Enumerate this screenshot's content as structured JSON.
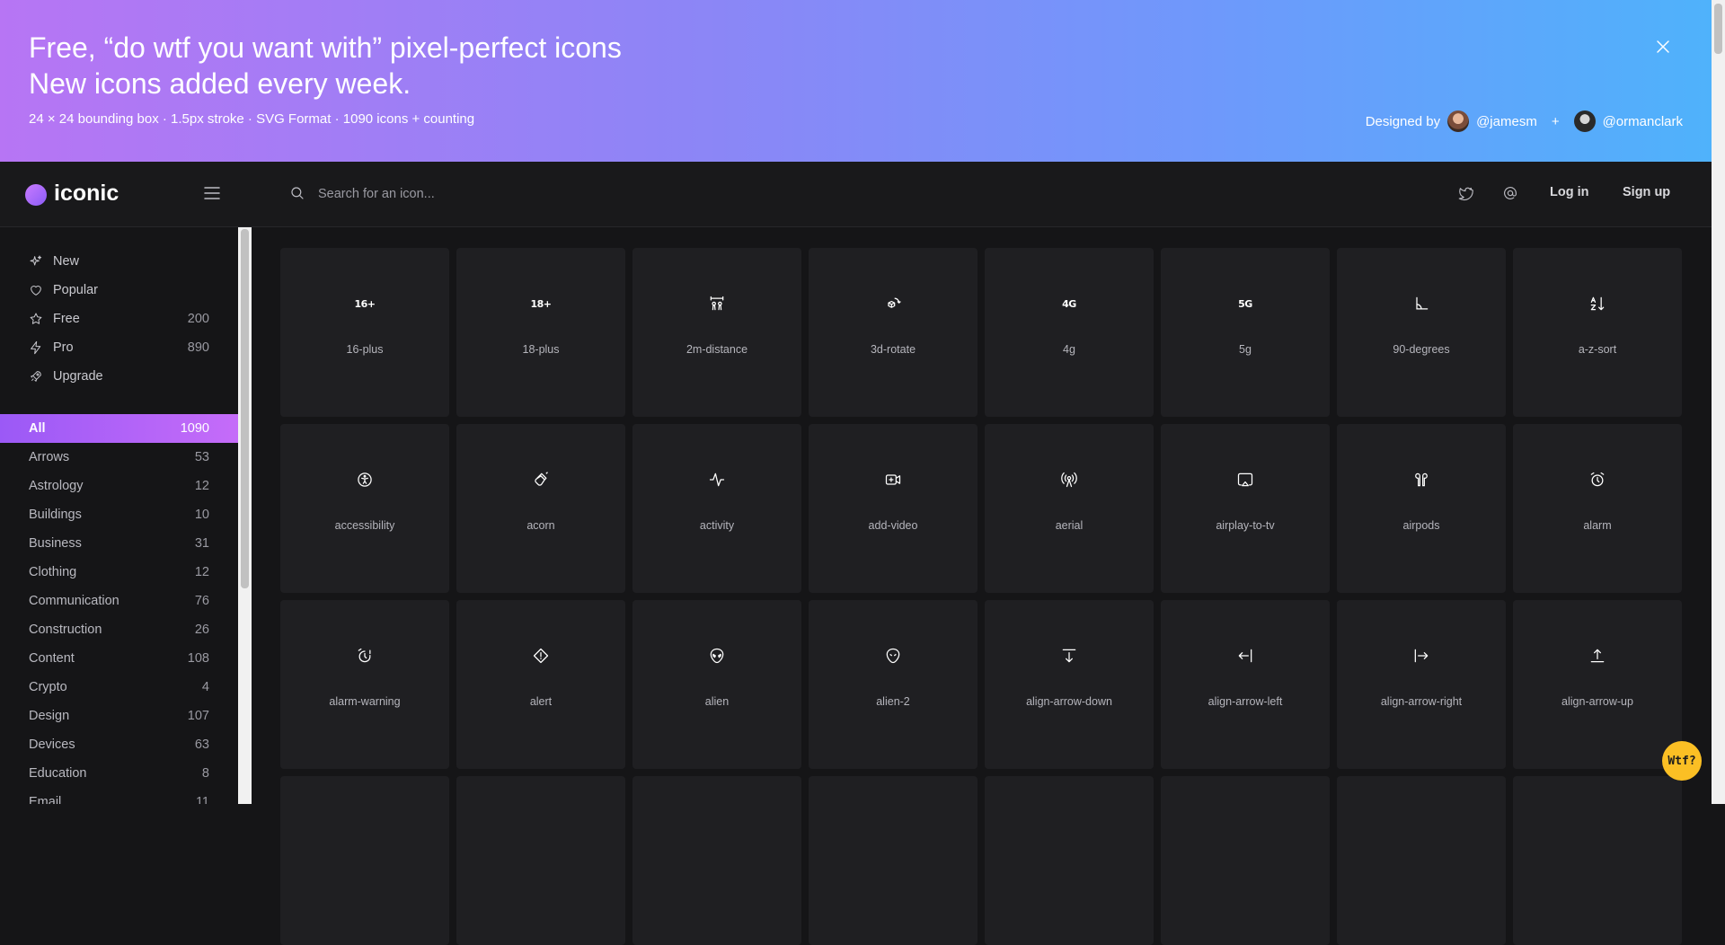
{
  "banner": {
    "title_line1": "Free, “do wtf you want with” pixel-perfect icons",
    "title_line2": "New icons added every week.",
    "subtitle": "24 × 24 bounding box · 1.5px stroke · SVG Format · 1090 icons + counting",
    "designed_by": "Designed by",
    "designer1": "@jamesm",
    "plus": "+",
    "designer2": "@ormanclark"
  },
  "brand": {
    "name": "iconic",
    "accent": "#a66cf7"
  },
  "search": {
    "placeholder": "Search for an icon..."
  },
  "topbar": {
    "login": "Log in",
    "signup": "Sign up"
  },
  "nav": [
    {
      "label": "New",
      "count": "",
      "icon": "sparkles-icon"
    },
    {
      "label": "Popular",
      "count": "",
      "icon": "heart-icon"
    },
    {
      "label": "Free",
      "count": "200",
      "icon": "star-icon"
    },
    {
      "label": "Pro",
      "count": "890",
      "icon": "lightning-icon"
    },
    {
      "label": "Upgrade",
      "count": "",
      "icon": "rocket-icon"
    }
  ],
  "categories": [
    {
      "label": "All",
      "count": "1090",
      "active": true
    },
    {
      "label": "Arrows",
      "count": "53"
    },
    {
      "label": "Astrology",
      "count": "12"
    },
    {
      "label": "Buildings",
      "count": "10"
    },
    {
      "label": "Business",
      "count": "31"
    },
    {
      "label": "Clothing",
      "count": "12"
    },
    {
      "label": "Communication",
      "count": "76"
    },
    {
      "label": "Construction",
      "count": "26"
    },
    {
      "label": "Content",
      "count": "108"
    },
    {
      "label": "Crypto",
      "count": "4"
    },
    {
      "label": "Design",
      "count": "107"
    },
    {
      "label": "Devices",
      "count": "63"
    },
    {
      "label": "Education",
      "count": "8"
    },
    {
      "label": "Email",
      "count": "11"
    }
  ],
  "icons": [
    {
      "name": "16-plus",
      "glyph": "16+"
    },
    {
      "name": "18-plus",
      "glyph": "18+"
    },
    {
      "name": "2m-distance",
      "glyph": ""
    },
    {
      "name": "3d-rotate",
      "glyph": ""
    },
    {
      "name": "4g",
      "glyph": "4G"
    },
    {
      "name": "5g",
      "glyph": "5G"
    },
    {
      "name": "90-degrees",
      "glyph": ""
    },
    {
      "name": "a-z-sort",
      "glyph": ""
    },
    {
      "name": "accessibility",
      "glyph": ""
    },
    {
      "name": "acorn",
      "glyph": ""
    },
    {
      "name": "activity",
      "glyph": ""
    },
    {
      "name": "add-video",
      "glyph": ""
    },
    {
      "name": "aerial",
      "glyph": ""
    },
    {
      "name": "airplay-to-tv",
      "glyph": ""
    },
    {
      "name": "airpods",
      "glyph": ""
    },
    {
      "name": "alarm",
      "glyph": ""
    },
    {
      "name": "alarm-warning",
      "glyph": ""
    },
    {
      "name": "alert",
      "glyph": ""
    },
    {
      "name": "alien",
      "glyph": ""
    },
    {
      "name": "alien-2",
      "glyph": ""
    },
    {
      "name": "align-arrow-down",
      "glyph": ""
    },
    {
      "name": "align-arrow-left",
      "glyph": ""
    },
    {
      "name": "align-arrow-right",
      "glyph": ""
    },
    {
      "name": "align-arrow-up",
      "glyph": ""
    }
  ],
  "wtf_button": "Wtf?"
}
